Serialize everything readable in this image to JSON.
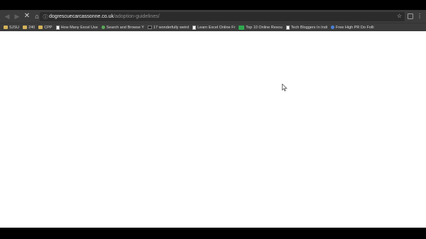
{
  "browser": {
    "url": {
      "host": "dogrescuecarcassonne.co.uk",
      "path": "/adoption-guidelines/"
    },
    "nav": {
      "back_icon": "arrow-left-icon",
      "forward_icon": "arrow-right-icon",
      "stop_icon": "close-icon",
      "home_icon": "home-icon"
    }
  },
  "bookmarks": [
    {
      "label": "SJSU",
      "icon": "folder-icon"
    },
    {
      "label": "240",
      "icon": "folder-icon"
    },
    {
      "label": "CPP",
      "icon": "folder-icon"
    },
    {
      "label": "How Many Excel Use",
      "icon": "page-icon"
    },
    {
      "label": "Search and Browse Y",
      "icon": "leaf-icon"
    },
    {
      "label": "17 wonderfully weird",
      "icon": "dark-icon"
    },
    {
      "label": "Learn Excel Online Fr",
      "icon": "page-icon"
    },
    {
      "label": "Top 10 Online Resou",
      "icon": "green-icon"
    },
    {
      "label": "Tech Bloggers In Indi",
      "icon": "page-icon"
    },
    {
      "label": "Free High PR Do Folli",
      "icon": "globe-icon"
    }
  ]
}
